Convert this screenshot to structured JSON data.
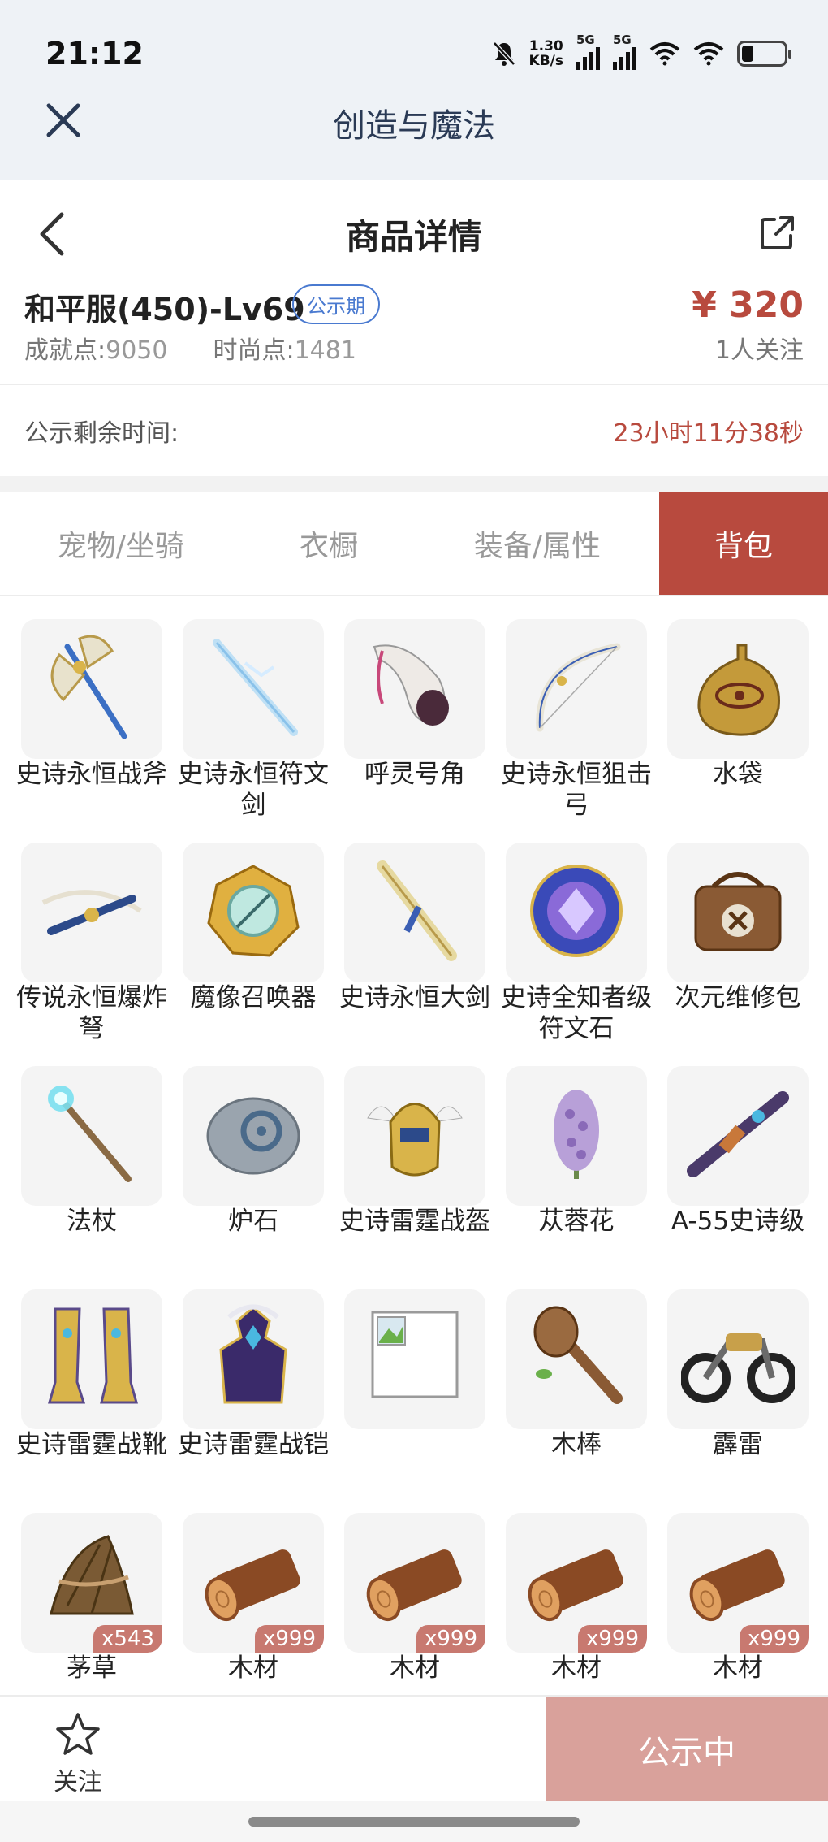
{
  "status_bar": {
    "time": "21:12",
    "net_speed_value": "1.30",
    "net_speed_unit": "KB/s",
    "signal1_tag": "5G",
    "signal2_tag": "5G"
  },
  "app_bar": {
    "title": "创造与魔法",
    "close_icon": "close-icon"
  },
  "page_header": {
    "title": "商品详情",
    "back_icon": "chevron-left-icon",
    "share_icon": "share-icon"
  },
  "summary": {
    "name": "和平服(450)-Lv69",
    "badge": "公示期",
    "achievement_label": "成就点:",
    "achievement_value": "9050",
    "fashion_label": "时尚点:",
    "fashion_value": "1481",
    "price": "¥ 320",
    "followers": "1人关注"
  },
  "countdown": {
    "label": "公示剩余时间:",
    "value": "23小时11分38秒"
  },
  "tabs": [
    {
      "label": "宠物/坐骑",
      "active": false
    },
    {
      "label": "衣橱",
      "active": false
    },
    {
      "label": "装备/属性",
      "active": false
    },
    {
      "label": "背包",
      "active": true
    }
  ],
  "items": [
    {
      "name": "史诗永恒战斧",
      "icon": "battle-axe-icon"
    },
    {
      "name": "史诗永恒符文剑",
      "icon": "rune-sword-icon"
    },
    {
      "name": "呼灵号角",
      "icon": "horn-icon"
    },
    {
      "name": "史诗永恒狙击弓",
      "icon": "bow-icon"
    },
    {
      "name": "水袋",
      "icon": "water-bag-icon"
    },
    {
      "name": "传说永恒爆炸弩",
      "icon": "crossbow-icon"
    },
    {
      "name": "魔像召唤器",
      "icon": "golem-summoner-icon"
    },
    {
      "name": "史诗永恒大剑",
      "icon": "greatsword-icon"
    },
    {
      "name": "史诗全知者级符文石",
      "icon": "rune-stone-icon"
    },
    {
      "name": "次元维修包",
      "icon": "repair-bag-icon"
    },
    {
      "name": "法杖",
      "icon": "staff-icon"
    },
    {
      "name": "炉石",
      "icon": "hearthstone-icon"
    },
    {
      "name": "史诗雷霆战盔",
      "icon": "helmet-icon"
    },
    {
      "name": "苁蓉花",
      "icon": "flower-icon"
    },
    {
      "name": "A-55史诗级",
      "icon": "rifle-icon"
    },
    {
      "name": "史诗雷霆战靴",
      "icon": "boots-icon"
    },
    {
      "name": "史诗雷霆战铠",
      "icon": "armor-icon"
    },
    {
      "name": "",
      "icon": "broken-image-icon"
    },
    {
      "name": "木棒",
      "icon": "club-icon"
    },
    {
      "name": "霹雷",
      "icon": "motorcycle-icon"
    },
    {
      "name": "茅草",
      "icon": "thatch-icon",
      "qty": "x543"
    },
    {
      "name": "木材",
      "icon": "wood-log-icon",
      "qty": "x999"
    },
    {
      "name": "木材",
      "icon": "wood-log-icon",
      "qty": "x999"
    },
    {
      "name": "木材",
      "icon": "wood-log-icon",
      "qty": "x999"
    },
    {
      "name": "木材",
      "icon": "wood-log-icon",
      "qty": "x999"
    }
  ],
  "bottom_bar": {
    "follow_label": "关注",
    "follow_icon": "star-icon",
    "action_label": "公示中"
  },
  "colors": {
    "accent": "#b84a3e",
    "badge_blue": "#4a7ad0",
    "action_disabled": "#d9a19b",
    "qty_badge": "#c87970"
  }
}
